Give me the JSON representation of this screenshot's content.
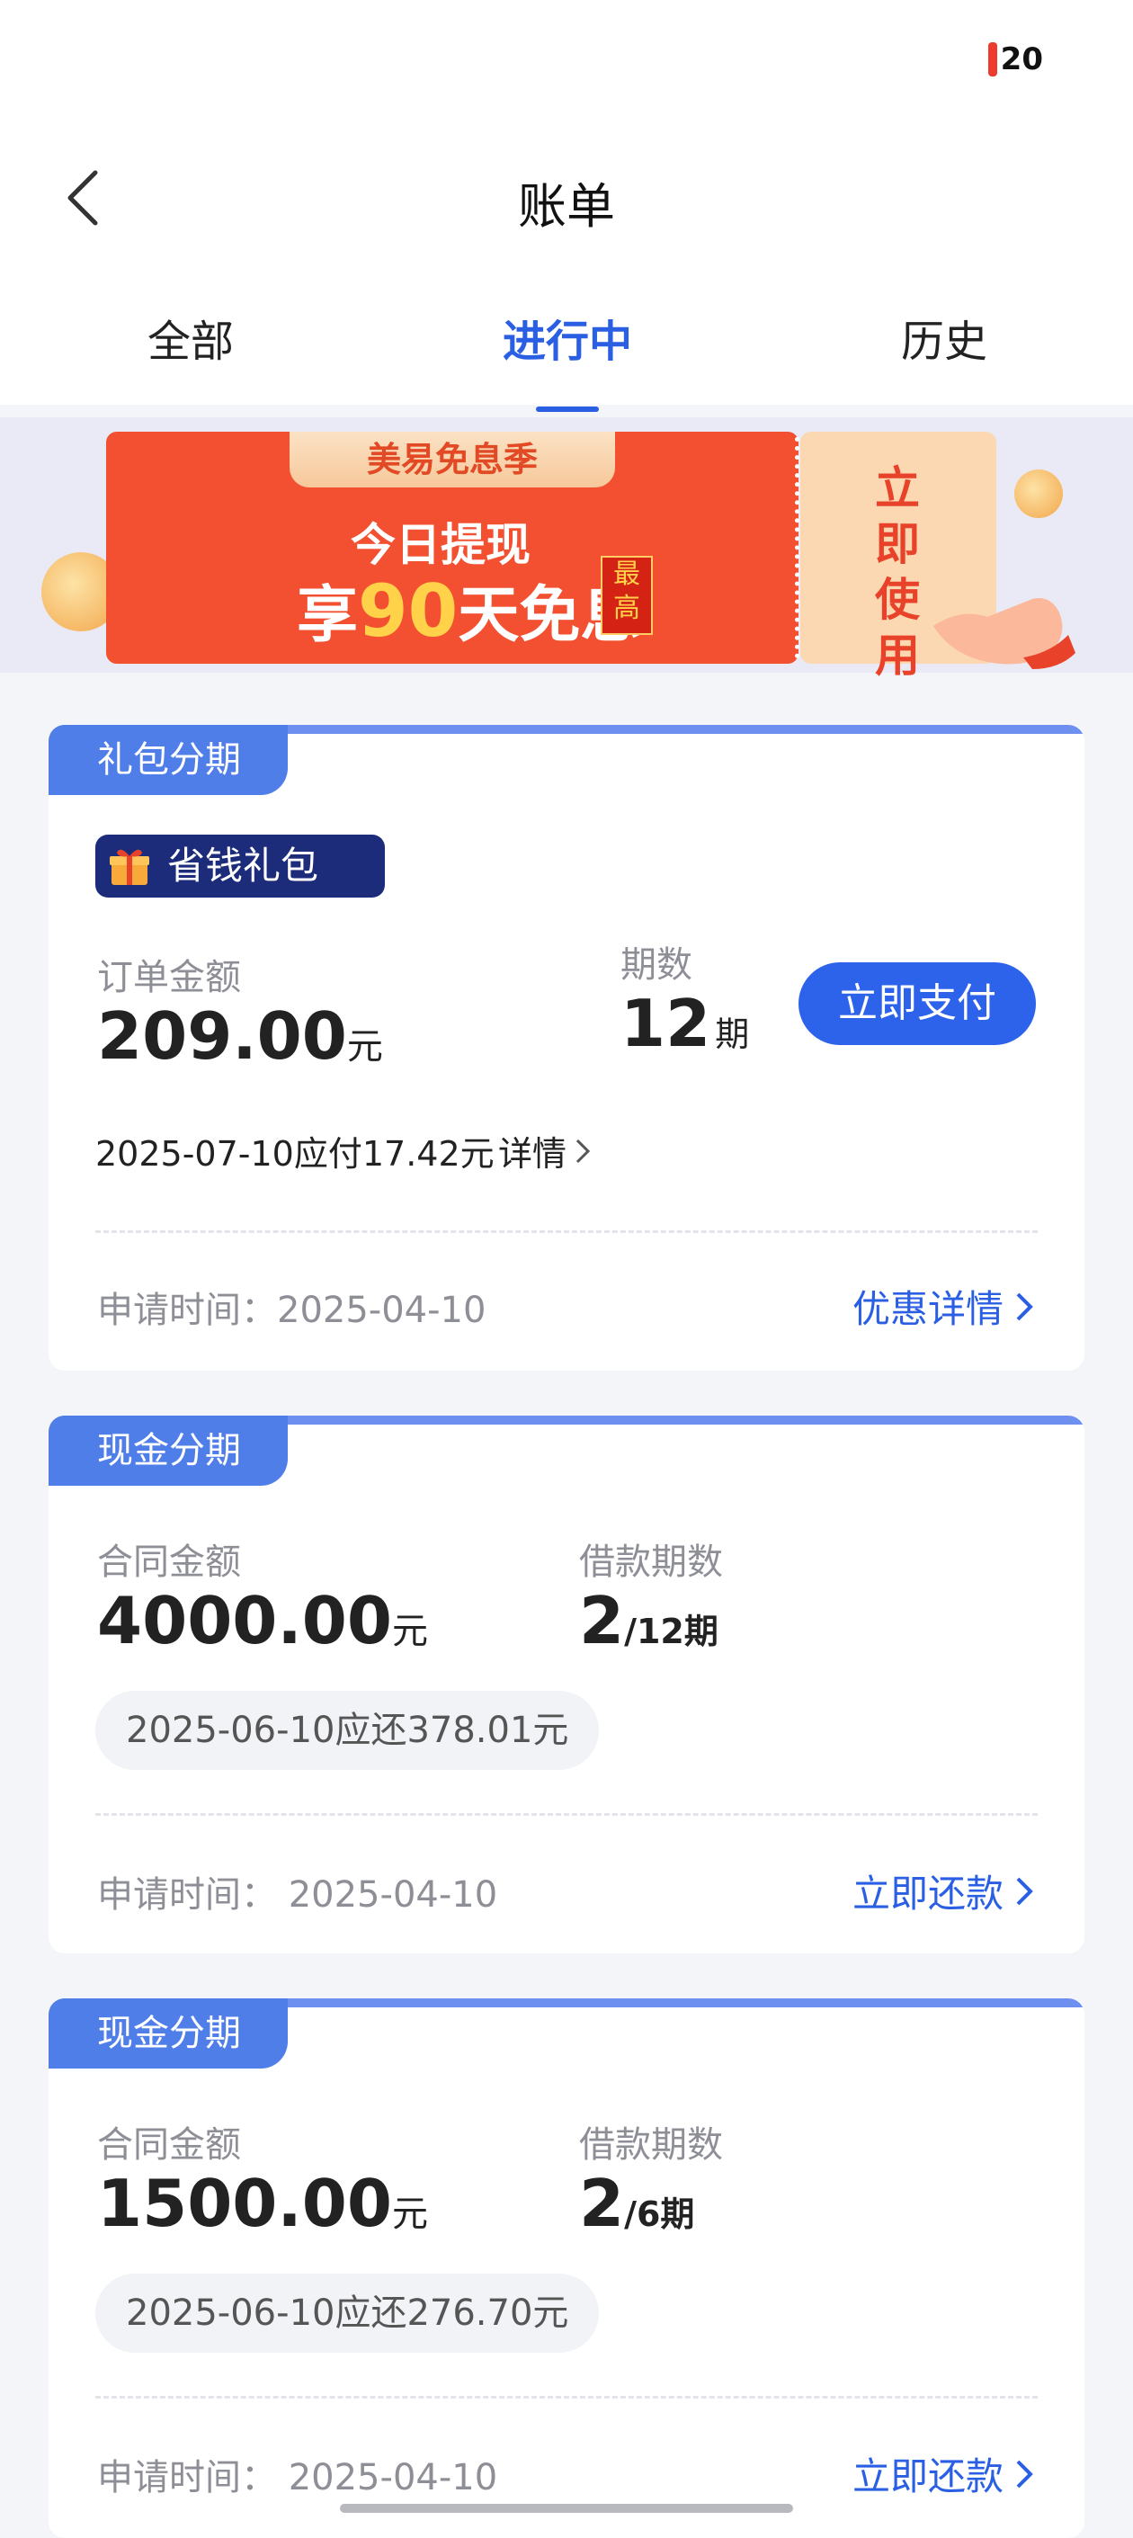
{
  "status": {
    "battery": "20"
  },
  "header": {
    "title": "账单"
  },
  "tabs": [
    {
      "label": "全部"
    },
    {
      "label": "进行中"
    },
    {
      "label": "历史"
    }
  ],
  "banner": {
    "tag": "美易免息季",
    "line1": "今日提现",
    "line2_prefix": "享",
    "line2_number": "90",
    "line2_suffix": "天免息",
    "badge": "最高",
    "ticket_text": "立即使用"
  },
  "cards": [
    {
      "label": "礼包分期",
      "gift_badge": "省钱礼包",
      "amount_label": "订单金额",
      "amount": "209.00",
      "amount_unit": "元",
      "period_label": "期数",
      "period": "12",
      "period_unit": "期",
      "pay_button": "立即支付",
      "due_text": "2025-07-10应付17.42元",
      "detail_link": "详情",
      "apply_text": "申请时间：2025-04-10",
      "action_link": "优惠详情"
    },
    {
      "label": "现金分期",
      "amount_label": "合同金额",
      "amount": "4000.00",
      "amount_unit": "元",
      "period_label": "借款期数",
      "period_current": "2",
      "period_total": "/12期",
      "due_text": "2025-06-10应还378.01元",
      "apply_text": "申请时间：  2025-04-10",
      "action_link": "立即还款"
    },
    {
      "label": "现金分期",
      "amount_label": "合同金额",
      "amount": "1500.00",
      "amount_unit": "元",
      "period_label": "借款期数",
      "period_current": "2",
      "period_total": "/6期",
      "due_text": "2025-06-10应还276.70元",
      "apply_text": "申请时间：  2025-04-10",
      "action_link": "立即还款"
    }
  ]
}
